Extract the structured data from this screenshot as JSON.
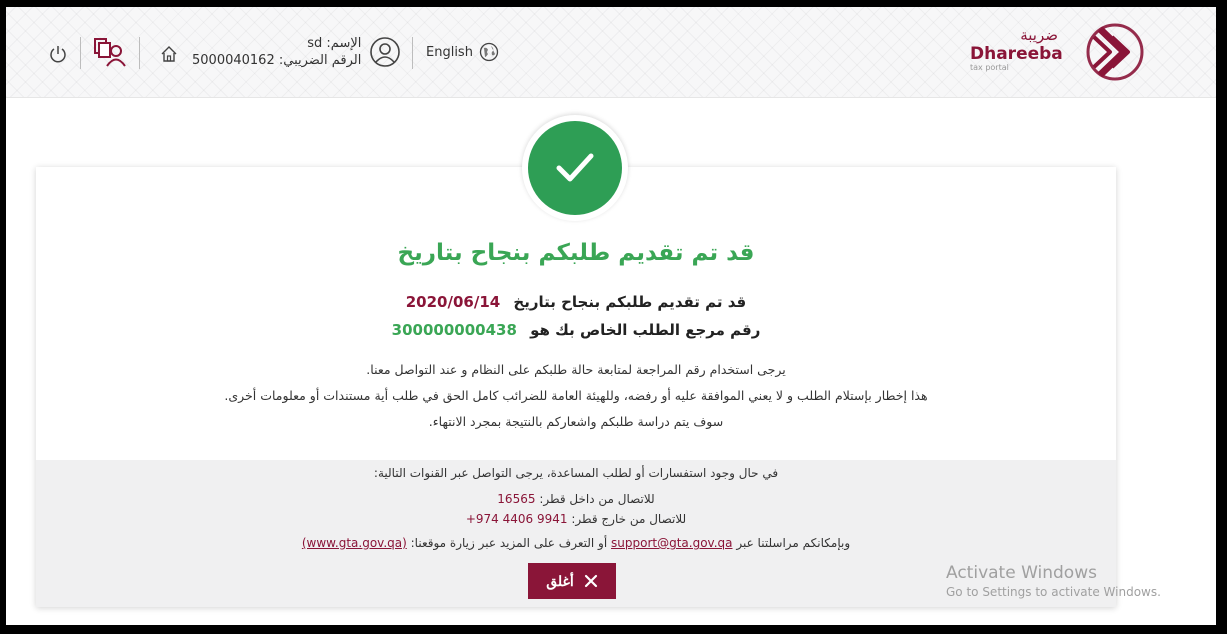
{
  "header": {
    "logo_ar": "ضريبة",
    "logo_en": "Dhareeba",
    "logo_sub": "tax portal",
    "language_label": "English",
    "user_name": "الإسم: sd",
    "tax_number": "الرقم الضريبي: 5000040162",
    "icons": [
      "power-icon",
      "documents-user-icon",
      "home-icon",
      "user-avatar-icon",
      "globe-icon"
    ]
  },
  "card": {
    "title": "قد تم تقديم طلبكم بنجاح بتاريخ",
    "submitted_label": "قد تم تقديم طلبكم بنجاح بتاريخ",
    "submitted_date": "2020/06/14",
    "reference_label": "رقم مرجع الطلب الخاص بك هو",
    "reference_number": "300000000438",
    "info_1": "يرجى استخدام رقم المراجعة لمتابعة حالة طلبكم على النظام و عند التواصل معنا.",
    "info_2": "هذا إخطار بإستلام الطلب و لا يعني الموافقة عليه أو رفضه، وللهيئة العامة للضرائب كامل الحق في طلب أية مستندات أو معلومات أخرى.",
    "info_3": "سوف يتم دراسة طلبكم واشعاركم بالنتيجة بمجرد الانتهاء."
  },
  "contact": {
    "intro": "في حال وجود استفسارات أو لطلب المساعدة، يرجى التواصل عبر القنوات التالية:",
    "inside_label": "للاتصال من داخل قطر:",
    "inside_number": "16565",
    "outside_label": "للاتصال من خارج قطر:",
    "outside_number": "+974 4406 9941",
    "mail_prefix": "وبإمكانكم مراسلتنا عبر",
    "email": "support@gta.gov.qa",
    "mail_middle": "أو التعرف على المزيد عبر زيارة موقعنا:",
    "website": "(www.gta.gov.qa)"
  },
  "close_button": "أغلق",
  "watermark": {
    "line1": "Activate Windows",
    "line2": "Go to Settings to activate Windows."
  },
  "colors": {
    "brand": "#8a1538",
    "success": "#3aa655"
  }
}
